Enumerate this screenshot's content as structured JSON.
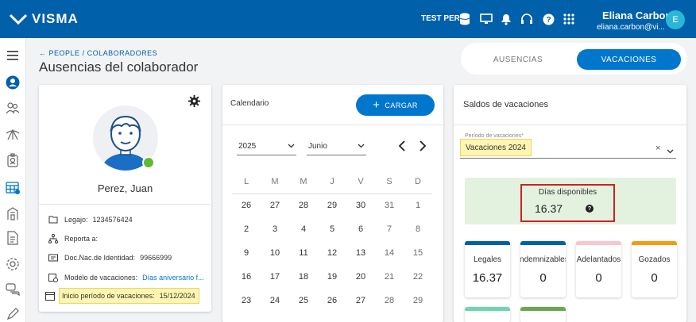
{
  "brand": {
    "logo_text": "VISMA",
    "primary": "#0060aa",
    "accent": "#0077cc"
  },
  "header": {
    "environment": "TEST PERÚ",
    "icons": [
      "database-icon",
      "monitor-icon",
      "bell-icon",
      "headset-icon",
      "help-icon",
      "apps-grid-icon"
    ],
    "user_name": "Eliana Carbon",
    "user_email": "eliana.carbon@vi...",
    "avatar_initial": "E"
  },
  "sidebar": {
    "items": [
      "menu-icon",
      "profile-icon",
      "people-icon",
      "absences-icon",
      "badge-icon",
      "calendar-icon",
      "org-icon",
      "document-icon",
      "settings-icon",
      "chat-icon",
      "edit-icon"
    ]
  },
  "breadcrumb": {
    "people": "PEOPLE",
    "separator": "/",
    "colaboradores": "COLABORADORES"
  },
  "page": {
    "title": "Ausencias del colaborador"
  },
  "tabs": {
    "ausencias": "AUSENCIAS",
    "vacaciones": "VACACIONES",
    "active": "VACACIONES"
  },
  "profile": {
    "name": "Perez, Juan",
    "status_color": "#5dbb2e",
    "fields": [
      {
        "label": "Legajo:",
        "value": "1234576424",
        "icon": "folder-icon"
      },
      {
        "label": "Reporta a:",
        "value": "",
        "icon": "hierarchy-icon"
      },
      {
        "label": "Doc.Nac.de Identidad:",
        "value": "99666999",
        "icon": "id-card-icon"
      },
      {
        "label": "Modelo de vacaciones:",
        "value": "Días aniversario f...",
        "icon": "vacation-model-icon"
      },
      {
        "label": "Inicio período de vacaciones:",
        "value": "15/12/2024",
        "icon": "calendar-icon"
      }
    ]
  },
  "calendar": {
    "title": "Calendario",
    "upload_label": "CARGAR",
    "year": "2025",
    "month": "Junio",
    "day_names": [
      "L",
      "M",
      "M",
      "J",
      "V",
      "S",
      "D"
    ],
    "weeks": [
      [
        "26",
        "27",
        "28",
        "29",
        "30",
        "31",
        "1"
      ],
      [
        "2",
        "3",
        "4",
        "5",
        "6",
        "7",
        "8"
      ],
      [
        "9",
        "10",
        "11",
        "12",
        "13",
        "14",
        "15"
      ],
      [
        "16",
        "17",
        "18",
        "19",
        "20",
        "21",
        "22"
      ],
      [
        "23",
        "24",
        "25",
        "26",
        "27",
        "28",
        "29"
      ]
    ]
  },
  "saldos": {
    "title": "Saldos de vacaciones",
    "period_label": "Período de vacaciones*",
    "period_value": "Vacaciones 2024",
    "available_label": "Días disponibles",
    "available_value": "16.37",
    "stats": [
      {
        "label": "Legales",
        "value": "16.37",
        "color": "#0060aa"
      },
      {
        "label": "Indemnizables",
        "value": "0",
        "color": "#0060aa"
      },
      {
        "label": "Adelantados",
        "value": "0",
        "color": "#f4c8d0"
      },
      {
        "label": "Gozados",
        "value": "0",
        "color": "#f39c12"
      }
    ],
    "stats_row2_colors": [
      "#6fd6b0",
      "#6aa84f"
    ]
  }
}
